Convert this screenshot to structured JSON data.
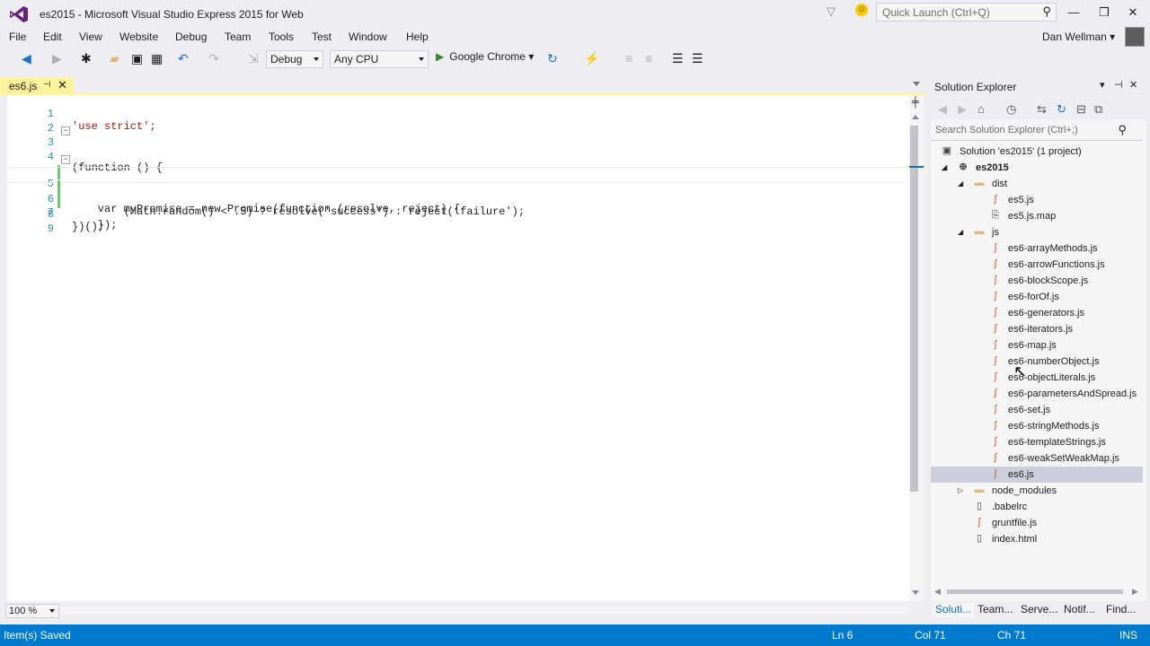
{
  "window": {
    "title": "es2015 - Microsoft Visual Studio Express 2015 for Web",
    "quick_launch_placeholder": "Quick Launch (Ctrl+Q)",
    "user_name": "Dan Wellman",
    "accent": "#007acc"
  },
  "menu": [
    "File",
    "Edit",
    "View",
    "Website",
    "Debug",
    "Team",
    "Tools",
    "Test",
    "Window",
    "Help"
  ],
  "toolbar": {
    "configuration": "Debug",
    "platform": "Any CPU",
    "run_target": "Google Chrome"
  },
  "editor": {
    "tab_label": "es6.js",
    "zoom": "100 %",
    "lines": [
      {
        "num": "1",
        "code": "'use strict';"
      },
      {
        "num": "2",
        "code": ""
      },
      {
        "num": "3",
        "code": "(function () {"
      },
      {
        "num": "4",
        "code": ""
      },
      {
        "num": "5",
        "code": "    var myPromise = new Promise(function (resolve, reject) {"
      },
      {
        "num": "6",
        "code": "        (Math.random() < .5) ? resolve('success') : reject('failure');"
      },
      {
        "num": "7",
        "code": "    });"
      },
      {
        "num": "8",
        "code": "})();"
      },
      {
        "num": "9",
        "code": ""
      }
    ]
  },
  "solution_explorer": {
    "title": "Solution Explorer",
    "search_placeholder": "Search Solution Explorer (Ctrl+;)",
    "tree": [
      {
        "label": "Solution 'es2015' (1 project)",
        "icon": "solution-icon"
      },
      {
        "label": "es2015",
        "icon": "web-project-icon"
      },
      {
        "label": "dist",
        "icon": "folder-icon"
      },
      {
        "label": "es5.js",
        "icon": "js-file-icon"
      },
      {
        "label": "es5.js.map",
        "icon": "map-file-icon"
      },
      {
        "label": "js",
        "icon": "folder-icon"
      },
      {
        "label": "es6-arrayMethods.js",
        "icon": "js-file-icon"
      },
      {
        "label": "es6-arrowFunctions.js",
        "icon": "js-file-icon"
      },
      {
        "label": "es6-blockScope.js",
        "icon": "js-file-icon"
      },
      {
        "label": "es6-forOf.js",
        "icon": "js-file-icon"
      },
      {
        "label": "es6-generators.js",
        "icon": "js-file-icon"
      },
      {
        "label": "es6-iterators.js",
        "icon": "js-file-icon"
      },
      {
        "label": "es6-map.js",
        "icon": "js-file-icon"
      },
      {
        "label": "es6-numberObject.js",
        "icon": "js-file-icon"
      },
      {
        "label": "es6-objectLiterals.js",
        "icon": "js-file-icon"
      },
      {
        "label": "es6-parametersAndSpread.js",
        "icon": "js-file-icon"
      },
      {
        "label": "es6-set.js",
        "icon": "js-file-icon"
      },
      {
        "label": "es6-stringMethods.js",
        "icon": "js-file-icon"
      },
      {
        "label": "es6-templateStrings.js",
        "icon": "js-file-icon"
      },
      {
        "label": "es6-weakSetWeakMap.js",
        "icon": "js-file-icon"
      },
      {
        "label": "es6.js",
        "icon": "js-file-icon"
      },
      {
        "label": "node_modules",
        "icon": "folder-icon"
      },
      {
        "label": ".babelrc",
        "icon": "file-icon"
      },
      {
        "label": "gruntfile.js",
        "icon": "js-file-icon"
      },
      {
        "label": "index.html",
        "icon": "html-file-icon"
      }
    ],
    "tabs": [
      "Soluti...",
      "Team...",
      "Serve...",
      "Notif...",
      "Find..."
    ]
  },
  "status": {
    "message": "Item(s) Saved",
    "line": "Ln 6",
    "col": "Col 71",
    "ch": "Ch 71",
    "mode": "INS"
  }
}
